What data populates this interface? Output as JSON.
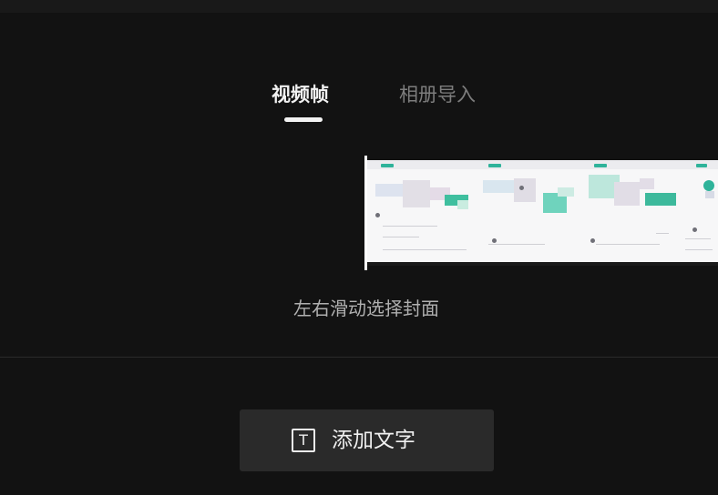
{
  "tabs": {
    "video_frame": "视频帧",
    "album_import": "相册导入"
  },
  "cover_picker": {
    "hint": "左右滑动选择封面"
  },
  "add_text": {
    "label": "添加文字",
    "icon": "text-t-icon"
  },
  "colors": {
    "background": "#121212",
    "active_tab": "#f2f2f2",
    "inactive_tab": "#7d7d7d",
    "button_bg": "#2a2a2a",
    "accent_teal": "#2fb39a"
  }
}
